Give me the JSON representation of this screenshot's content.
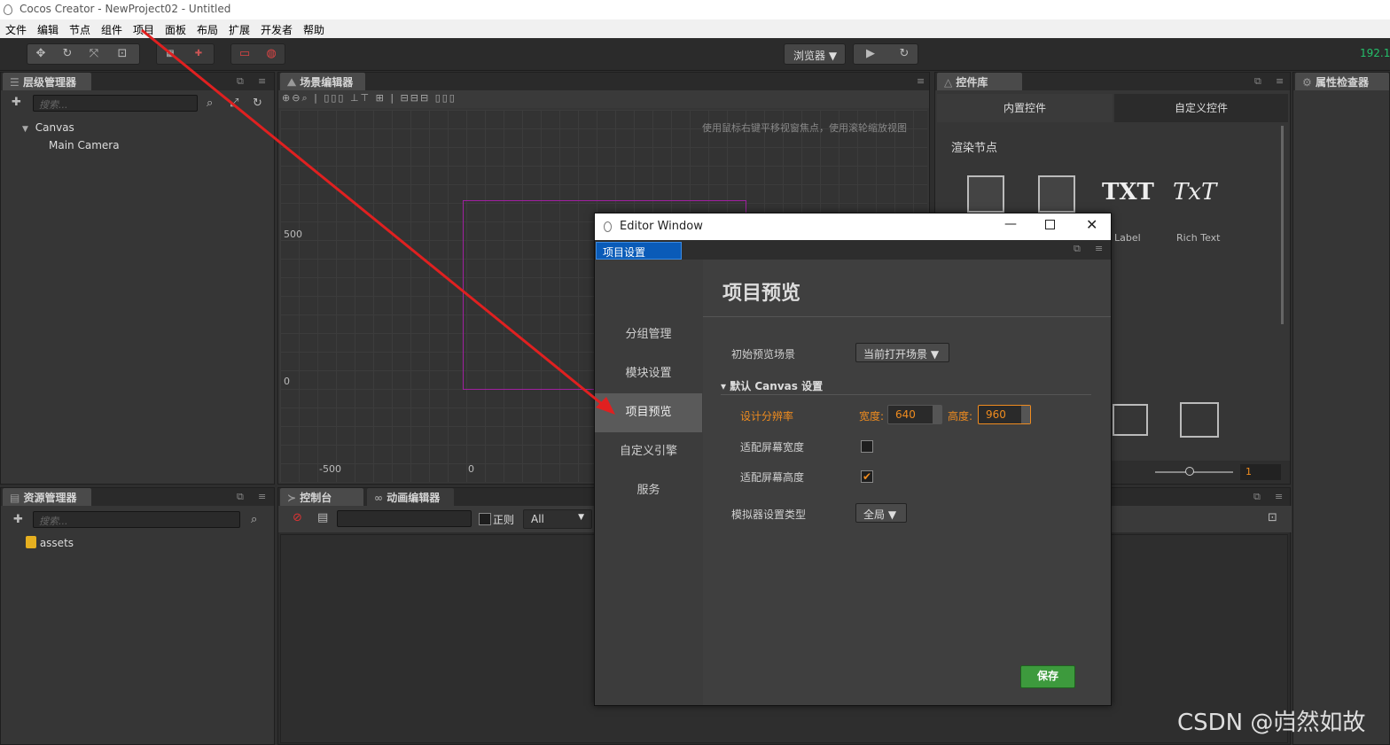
{
  "window": {
    "title": "Cocos Creator - NewProject02 - Untitled"
  },
  "menu": [
    "文件",
    "编辑",
    "节点",
    "组件",
    "项目",
    "面板",
    "布局",
    "扩展",
    "开发者",
    "帮助"
  ],
  "toolbar": {
    "platform": "浏览器 ▼",
    "ip": "192.1("
  },
  "hierarchy": {
    "tab": "层级管理器",
    "search_placeholder": "搜索...",
    "nodes": [
      "Canvas",
      "Main Camera"
    ]
  },
  "scene": {
    "tab": "场景编辑器",
    "hint": "使用鼠标右键平移视窗焦点，使用滚轮缩放视图",
    "y_labels": [
      "500",
      "0"
    ],
    "x_labels": [
      "-500",
      "0"
    ]
  },
  "widgets": {
    "tab": "控件库",
    "subtab_builtin": "内置控件",
    "subtab_custom": "自定义控件",
    "section": "渲染节点",
    "items": [
      "TXT",
      "TxT"
    ],
    "item_labels": [
      "Label",
      "Rich Text"
    ],
    "slider_value": "1"
  },
  "inspector": {
    "tab": "属性检查器"
  },
  "assets": {
    "tab": "资源管理器",
    "search_placeholder": "搜索...",
    "root": "assets"
  },
  "console": {
    "tab": "控制台",
    "regex_label": "正则",
    "filter": "All"
  },
  "animation": {
    "tab": "动画编辑器"
  },
  "editor_window": {
    "title": "Editor Window",
    "tab": "项目设置",
    "nav": [
      "分组管理",
      "模块设置",
      "项目预览",
      "自定义引擎",
      "服务"
    ],
    "active_nav": "项目预览",
    "heading": "项目预览",
    "start_scene_label": "初始预览场景",
    "start_scene_value": "当前打开场景 ▼",
    "canvas_section": "▾ 默认 Canvas 设置",
    "design_res_label": "设计分辨率",
    "width_label": "宽度:",
    "width_value": "640",
    "height_label": "高度:",
    "height_value": "960",
    "fit_width_label": "适配屏幕宽度",
    "fit_width_checked": false,
    "fit_height_label": "适配屏幕高度",
    "fit_height_checked": true,
    "sim_label": "模拟器设置类型",
    "sim_value": "全局 ▼",
    "save": "保存"
  },
  "watermark": "CSDN @岿然如故",
  "colors": {
    "accent_orange": "#f08c1f",
    "tab_blue": "#0a5bb8",
    "save_green": "#3d9a3d",
    "arrow_red": "#e02020"
  }
}
